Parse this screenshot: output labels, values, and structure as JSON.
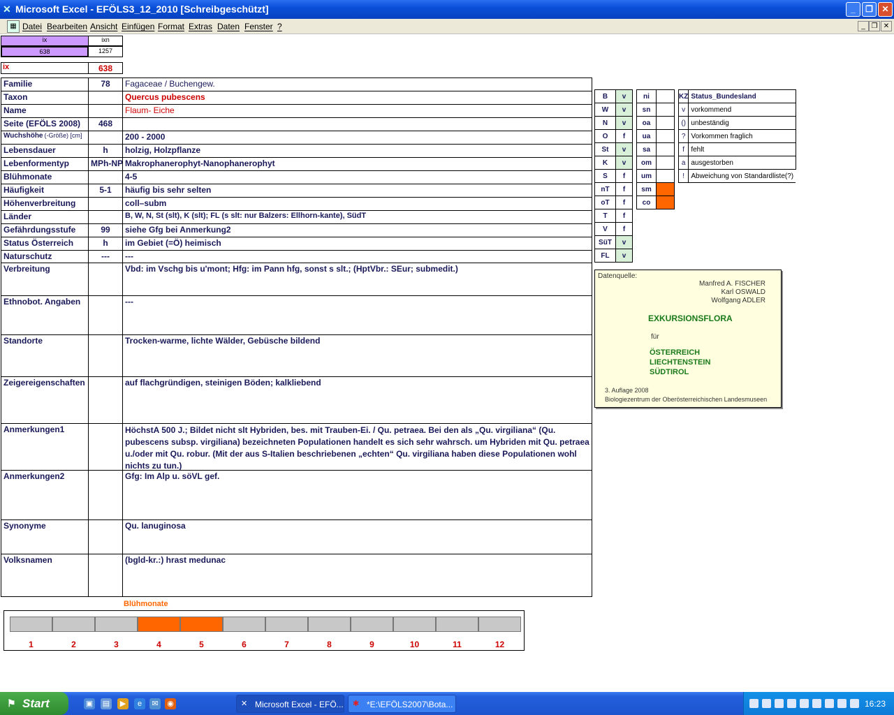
{
  "window": {
    "title": "Microsoft Excel - EFÖLS3_12_2010  [Schreibgeschützt]"
  },
  "menu": [
    "Datei",
    "Bearbeiten",
    "Ansicht",
    "Einfügen",
    "Format",
    "Extras",
    "Daten",
    "Fenster",
    "?"
  ],
  "top": {
    "h1": "ix",
    "h2": "ixn",
    "v1": "638",
    "v2": "1257",
    "ix_label": "ix",
    "ix_value": "638"
  },
  "rows": [
    {
      "label": "Familie",
      "code": "78",
      "value": "Fagaceae  /  Buchengew."
    },
    {
      "label": "Taxon",
      "code": "",
      "value": "Quercus pubescens"
    },
    {
      "label": "Name",
      "code": "",
      "value": "Flaum- Eiche"
    },
    {
      "label": "Seite (EFÖLS 2008)",
      "code": "468",
      "value": ""
    },
    {
      "label": "Wuchshöhe",
      "label_suffix": "(-Größe) [cm]",
      "code": "",
      "value": "200 - 2000"
    },
    {
      "label": "Lebensdauer",
      "code": "h",
      "value": "holzig, Holzpflanze"
    },
    {
      "label": "Lebenformentyp",
      "code": "MPh-NPh",
      "value": "Makrophanerophyt-Nanophanerophyt"
    },
    {
      "label": "Blühmonate",
      "code": "",
      "value": "4-5"
    },
    {
      "label": "Häufigkeit",
      "code": "5-1",
      "value": "häufig bis sehr selten"
    },
    {
      "label": "Höhenverbreitung",
      "code": "",
      "value": "coll–subm"
    },
    {
      "label": "Länder",
      "code": "",
      "value": "B, W, N, St (slt), K (slt); FL (s slt: nur Balzers: Ellhorn-kante), SüdT"
    },
    {
      "label": "Gefährdungsstufe",
      "code": "99",
      "value": "siehe Gfg bei Anmerkung2"
    },
    {
      "label": "Status Österreich",
      "code": "h",
      "value": "im Gebiet (=Ö) heimisch"
    },
    {
      "label": "Naturschutz",
      "code": "---",
      "value": "---"
    },
    {
      "label": "Verbreitung",
      "code": "",
      "value": "Vbd: im Vschg bis u'mont; Hfg:  im Pann hfg, sonst s slt.;  (HptVbr.: SEur; submedit.)"
    },
    {
      "label": "Ethnobot. Angaben",
      "code": "",
      "value": "---"
    },
    {
      "label": "Standorte",
      "code": "",
      "value": "Trocken-warme, lichte Wälder, Gebüsche bildend"
    },
    {
      "label": "Zeigereigenschaften",
      "code": "",
      "value": "auf flachgründigen, steinigen Böden; kalkliebend"
    },
    {
      "label": "Anmerkungen1",
      "code": "",
      "value": "HöchstA 500 J.;  Bildet nicht slt Hybriden, bes. mit Trauben-Ei. / Qu. petraea. Bei den als „Qu. virgiliana“ (Qu. pubescens subsp. virgiliana) bezeichneten Populationen handelt es sich sehr wahrsch. um Hybriden mit Qu. petraea u./oder mit Qu. robur. (Mit der aus S-Italien beschriebenen „echten“ Qu. virgiliana haben diese Populationen wohl nichts zu tun.)"
    },
    {
      "label": "Anmerkungen2",
      "code": "",
      "value": "Gfg: Im Alp u. söVL gef."
    },
    {
      "label": "Synonyme",
      "code": "",
      "value": "Qu. lanuginosa"
    },
    {
      "label": "Volksnamen",
      "code": "",
      "value": "(bgld-kr.:) hrast medunac"
    }
  ],
  "states": [
    {
      "k": "B",
      "v": "v"
    },
    {
      "k": "W",
      "v": "v"
    },
    {
      "k": "N",
      "v": "v"
    },
    {
      "k": "O",
      "v": "f"
    },
    {
      "k": "St",
      "v": "v"
    },
    {
      "k": "K",
      "v": "v"
    },
    {
      "k": "S",
      "v": "f"
    },
    {
      "k": "nT",
      "v": "f"
    },
    {
      "k": "oT",
      "v": "f"
    },
    {
      "k": "T",
      "v": "f"
    },
    {
      "k": "V",
      "v": "f"
    },
    {
      "k": "SüT",
      "v": "v"
    },
    {
      "k": "FL",
      "v": "v"
    }
  ],
  "zones": [
    {
      "k": "ni",
      "on": false
    },
    {
      "k": "sn",
      "on": false
    },
    {
      "k": "oa",
      "on": false
    },
    {
      "k": "ua",
      "on": false
    },
    {
      "k": "sa",
      "on": false
    },
    {
      "k": "om",
      "on": false
    },
    {
      "k": "um",
      "on": false
    },
    {
      "k": "sm",
      "on": true
    },
    {
      "k": "co",
      "on": true
    }
  ],
  "legend": {
    "head_k": "KZ",
    "head_v": "Status_Bundesland",
    "items": [
      {
        "k": "v",
        "v": "vorkommend"
      },
      {
        "k": "()",
        "v": "unbeständig"
      },
      {
        "k": "?",
        "v": "Vorkommen fraglich"
      },
      {
        "k": "f",
        "v": "fehlt"
      },
      {
        "k": "a",
        "v": "ausgestorben"
      },
      {
        "k": "!",
        "v": "Abweichung von Standardliste(?)"
      }
    ]
  },
  "source": {
    "label": "Datenquelle:",
    "a1": "Manfred A. FISCHER",
    "a2": "Karl OSWALD",
    "a3": "Wolfgang ADLER",
    "title": "EXKURSIONSFLORA",
    "fuer": "für",
    "c1": "ÖSTERREICH",
    "c2": "LIECHTENSTEIN",
    "c3": "SÜDTIROL",
    "ed": "3. Auflage 2008",
    "pub": "Biologiezentrum der Oberösterreichischen Landesmuseen"
  },
  "bloom": {
    "title": "Blühmonate",
    "months": [
      "1",
      "2",
      "3",
      "4",
      "5",
      "6",
      "7",
      "8",
      "9",
      "10",
      "11",
      "12"
    ],
    "active": [
      4,
      5
    ]
  },
  "taskbar": {
    "start": "Start",
    "tasks": [
      "Microsoft Excel - EFÖ...",
      "*E:\\EFÖLS2007\\Bota..."
    ],
    "clock": "16:23"
  },
  "colors": {
    "accent_orange": "#ff6600",
    "green_cell": "#d8f0d8",
    "purple": "#cc99ff"
  }
}
